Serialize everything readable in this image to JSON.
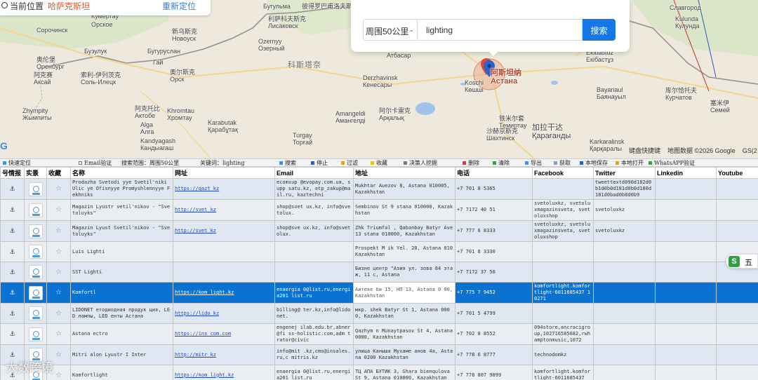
{
  "location_bar": {
    "label": "当前位置",
    "value": "哈萨克斯坦",
    "relocate": "重新定位"
  },
  "search": {
    "radius_label": "周围50公里",
    "query": "lighting",
    "button": "搜索"
  },
  "map": {
    "cities": [
      "Кумертау",
      "Орское",
      "Сорочинск",
      "Бузулук",
      "Бугуруслан",
      "Бугульма",
      "新乌斯克\nНовоуск",
      "索利-伊列茨克\nСоль-Илецк",
      "阿克赛\nАксай",
      "奥伦堡\nОренбург",
      "奥尔斯克\nОрск",
      "Гай",
      "Zhympity\nЖымпиты",
      "阿克托比\nАктобе",
      "Khromtau\nХромтау",
      "Alga\nАлга",
      "Kandyagash\nКандыагаш",
      "Karabutak\nҚарабұтақ",
      "Turgay\nТорғай",
      "科斯塔奈",
      "Ozernyy\nОзерный",
      "利萨科夫斯克\nЛисаковск",
      "彼得罗巴甫洛夫斯克",
      "Derzhavinsk\nКенесары",
      "Amangeldi\nАмангелді",
      "阿尔卡雷克\nАрқалық",
      "Атбасар",
      "Koschi\nКөшші",
      "铁米尔套\nТемиртау",
      "沙赫京斯克\nШахтинск",
      "加拉干达\nҚарағанды",
      "Ekibastuz\nЕкібастұз",
      "Bayanaul\nБаянауыл",
      "库尔恰托夫\nКурчатов",
      "塞米伊\nСемей",
      "Славгород",
      "Kulunda\nКулунда",
      "Karkaralinsk\nҚарқаралы",
      "Eкибастуз"
    ],
    "astana": "阿斯坦纳\nАстана",
    "attribution": [
      "键盘快捷键",
      "地图数据 ©2026 Google",
      "GS(2"
    ],
    "logo": "Google"
  },
  "toolbar": [
    "快速定位",
    "Email验证",
    "搜索范围：周围50公里",
    "关键词：lighting",
    "搜索",
    "停止",
    "过滤",
    "收藏",
    "决策人挖掘",
    "删除",
    "清除",
    "导出",
    "获取",
    "本地保存",
    "本地打开",
    "WhatsAPP验证"
  ],
  "table": {
    "headers": [
      "号情报",
      "实景",
      "收藏",
      "名称",
      "网址",
      "Email",
      "地址",
      "电话",
      "Facebook",
      "Twitter",
      "Linkedin",
      "Youtube"
    ],
    "rows": [
      {
        "name": "Prodazha Svetodi yye Svetil'niki Ulic ye Ofisnyye Promyshlennyye F ekhniks",
        "url": "https://qazt kz",
        "email": "ecomsup @evopay.com.ua, supp satu.kz, atp_zakup@mail.ru, kaztechni",
        "address": "Mukhtar Auezov 8, Astana 010005, Kazakhstan",
        "phone": "+7 701 8 5365",
        "facebook": "",
        "twitter": "tweettextd090d182d0b1d0b0d181d0b0d180d181d0bad0b8d0b9",
        "linkedin": "",
        "youtube": ""
      },
      {
        "name": "Magazin Lyustr vetil'nikov - \"Svetoluyks\"",
        "url": "http://svet kz",
        "email": "shop@svet ux.kz, info@svetolux.",
        "address": "Sembinov St 9 stana 010000, Kazakhstan",
        "phone": "+7 7172 40 51",
        "facebook": "svetoluxkz, svetoluxmagazinsveta, svetoluxshop",
        "twitter": "svetoluxkz",
        "linkedin": "",
        "youtube": ""
      },
      {
        "name": "Magazin Lyust Svetil'nikov - \"Svetoluyks\"",
        "url": "http://svet kz",
        "email": "shop@sve ux.kz, info@svetolux.",
        "address": "Zhk Triumfal , Qabanbay Batyr Ave 13 stana 010000, Kazakhstan",
        "phone": "+7 777 6 8333",
        "facebook": "svetoluxkz, svetoluxmagazinsveta, svetoluxshop",
        "twitter": "svetoluxkz",
        "linkedin": "",
        "youtube": ""
      },
      {
        "name": "Luis Lighti",
        "url": "",
        "email": "",
        "address": "Prospekt M ik Yel. 28, Astana 010 Kazakhstan",
        "phone": "+7 701 8 3330",
        "facebook": "",
        "twitter": "",
        "linkedin": "",
        "youtube": ""
      },
      {
        "name": "SST Lighti",
        "url": "",
        "email": "",
        "address": "Бизне центр \"Азия ул. зова 84 этаж, 11 с, Astana",
        "phone": "+7 7172 37 56",
        "facebook": "",
        "twitter": "",
        "linkedin": "",
        "youtube": ""
      },
      {
        "name": "Komfortl",
        "url": "https://kom light.kz",
        "email": "enaergia 0@list.ru,energia201 list.ru",
        "address": "Аитеке би 15, НП 13, Astana 0 00, Kazakhstan",
        "phone": "+7 775 7 9452",
        "facebook": "komfortlight.komfortlight-6011685437 10271",
        "twitter": "",
        "linkedin": "",
        "youtube": "",
        "selected": true
      },
      {
        "name": "LIDONET етодиодная продук ция, LED лампы, LED енты Астана",
        "url": "https://lido kz",
        "email": "billing@ ter.kz,info@lidonet.",
        "address": "мкр. shek Batyr St 1, Astana 0000, Kazakhstan",
        "phone": "+7 701 5 4799",
        "facebook": "",
        "twitter": "",
        "linkedin": "",
        "youtube": ""
      },
      {
        "name": "Astana ectro",
        "url": "https://ins com.com",
        "email": "engenej ilab.edu.br,abner@fi ss-holistic.com,adm trator@civic",
        "address": "Qazhym n Munaytpasov St 4, Astana 0000, Kazakhstan",
        "phone": "+7 702 8 8552",
        "facebook": "094store,ancracigroup,102716585682,rwhamptonmusic,1072",
        "twitter": "",
        "linkedin": "",
        "youtube": ""
      },
      {
        "name": "Mitri alon Lyustr I Inter",
        "url": "http://mitr kz",
        "email": "info@mit .kz,cms@insales.ru,c mitris.kz",
        "address": "улица Каныша Мухаме анов 4а, Astana 0200 Kazakhstan",
        "phone": "+7 778 6 8777",
        "facebook": "technodomkz",
        "twitter": "",
        "linkedin": "",
        "youtube": ""
      },
      {
        "name": "Komfortlight",
        "url": "https://kom light.kz",
        "email": "enaergia 0@list.ru,energia201 list.ru",
        "address": "ТЦ АПА БУТИК 3, Shara bienqulova St 9, Astana 010000, Kazakhstan",
        "phone": "+7 778 807 9899",
        "facebook": "komfortlight.komfortlight-6011685437",
        "twitter": "",
        "linkedin": "",
        "youtube": ""
      }
    ]
  },
  "overlay": {
    "watermark": "大数跨境",
    "ime": "五"
  }
}
